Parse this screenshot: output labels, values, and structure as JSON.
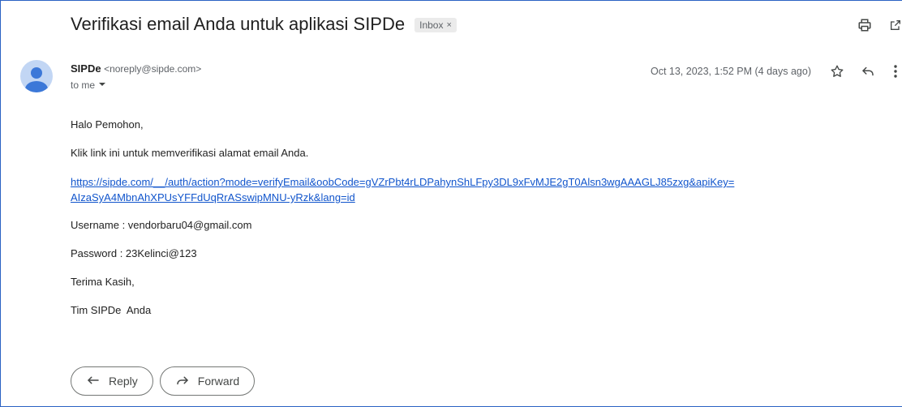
{
  "subject": {
    "title": "Verifikasi email Anda untuk aplikasi SIPDe",
    "label": "Inbox",
    "label_remove": "×"
  },
  "message": {
    "sender_name": "SIPDe",
    "sender_email": "<noreply@sipde.com>",
    "recipient": "to me",
    "date": "Oct 13, 2023, 1:52 PM (4 days ago)"
  },
  "body": {
    "greeting": "Halo Pemohon,",
    "instruction": "Klik link ini untuk memverifikasi alamat email Anda.",
    "link_line1": "https://sipde.com/__/auth/action?mode=verifyEmail&oobCode=gVZrPbt4rLDPahynShLFpy3DL9xFvMJE2gT0Alsn3wgAAAGLJ85zxg&apiKey=",
    "link_line2": "AIzaSyA4MbnAhXPUsYFFdUqRrASswipMNU-yRzk&lang=id",
    "username": "Username : vendorbaru04@gmail.com",
    "password": "Password : 23Kelinci@123",
    "closing": "Terima Kasih,",
    "signature": "Tim SIPDe  Anda"
  },
  "actions": {
    "reply": "Reply",
    "forward": "Forward"
  },
  "icons": {
    "print": "print-icon",
    "open_new": "open-in-new-window-icon",
    "star": "star-icon",
    "reply": "reply-icon",
    "more": "more-vertical-icon",
    "dropdown": "chevron-down-icon",
    "avatar": "default-avatar-icon",
    "forward": "forward-icon"
  },
  "colors": {
    "link": "#1155cc",
    "frame_border": "#2b62c3",
    "avatar_bg": "#c2d6f4",
    "avatar_fg": "#3c78d8"
  }
}
